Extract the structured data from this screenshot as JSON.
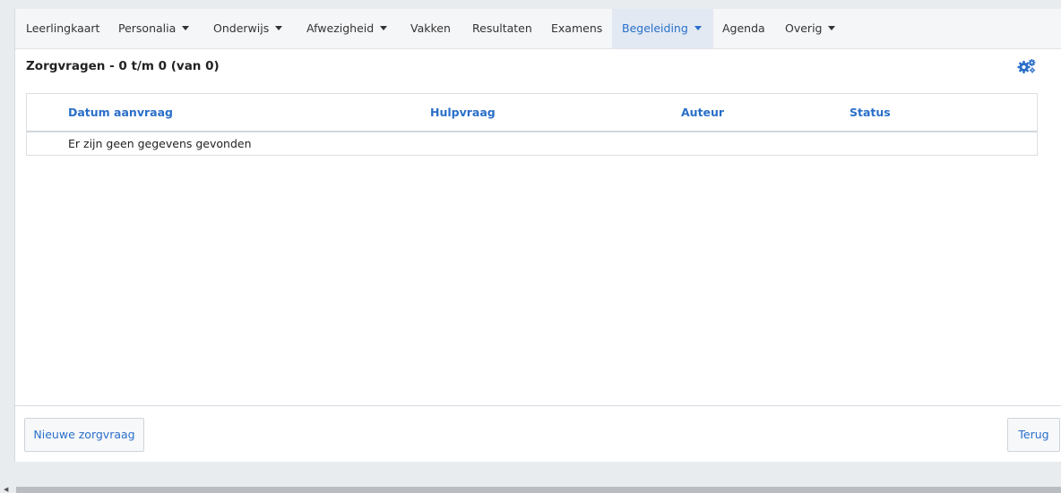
{
  "nav": {
    "items": [
      {
        "label": "Leerlingkaart",
        "dropdown": false,
        "active": false
      },
      {
        "label": "Personalia",
        "dropdown": true,
        "active": false
      },
      {
        "label": "Onderwijs",
        "dropdown": true,
        "active": false
      },
      {
        "label": "Afwezigheid",
        "dropdown": true,
        "active": false
      },
      {
        "label": "Vakken",
        "dropdown": false,
        "active": false
      },
      {
        "label": "Resultaten",
        "dropdown": false,
        "active": false
      },
      {
        "label": "Examens",
        "dropdown": false,
        "active": false
      },
      {
        "label": "Begeleiding",
        "dropdown": true,
        "active": true
      },
      {
        "label": "Agenda",
        "dropdown": false,
        "active": false
      },
      {
        "label": "Overig",
        "dropdown": true,
        "active": false
      }
    ]
  },
  "main": {
    "title": "Zorgvragen - 0 t/m 0 (van 0)",
    "settings_icon": "gears-icon"
  },
  "table": {
    "columns": [
      "Datum aanvraag",
      "Hulpvraag",
      "Auteur",
      "Status"
    ],
    "empty_message": "Er zijn geen gegevens gevonden"
  },
  "footer": {
    "new_label": "Nieuwe zorgvraag",
    "back_label": "Terug"
  },
  "colors": {
    "accent": "#2a6fc9",
    "nav_background": "#f5f6f8",
    "active_tab_background": "#e2e9f3",
    "page_background": "#e9ecef"
  }
}
